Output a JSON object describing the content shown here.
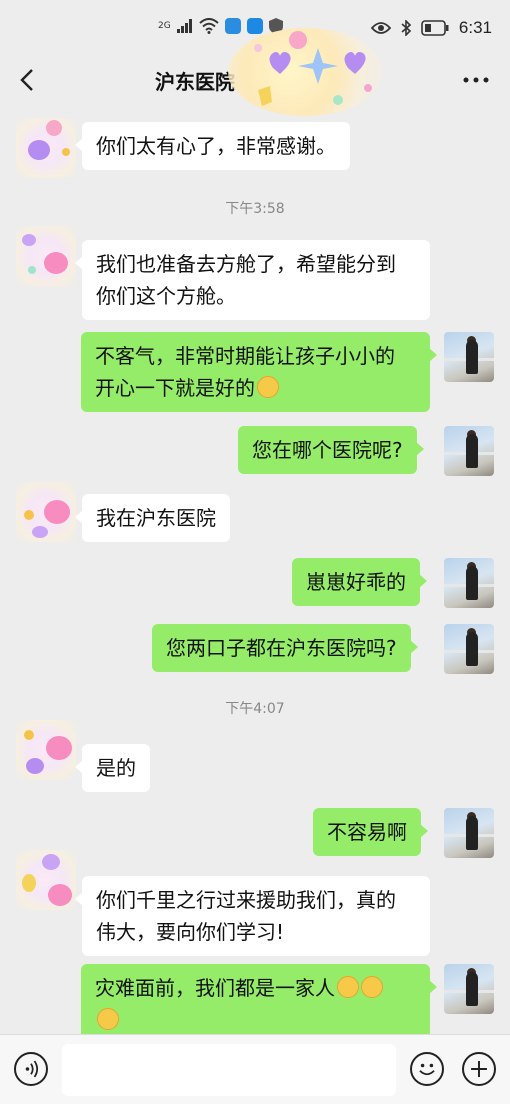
{
  "status_bar": {
    "network": "2G",
    "time": "6:31"
  },
  "header": {
    "title": "沪东医院"
  },
  "messages": [
    {
      "side": "left",
      "text": "你们太有心了，非常感谢。"
    },
    {
      "type": "time",
      "text": "下午3:58"
    },
    {
      "side": "left",
      "lines": [
        "我们也准备去方舱了，希望能分到",
        "你们这个方舱。"
      ]
    },
    {
      "side": "right",
      "lines": [
        "不客气，非常时期能让孩子小小的",
        "开心一下就是好的"
      ],
      "emoji_count": 1
    },
    {
      "side": "right",
      "text": "您在哪个医院呢?"
    },
    {
      "side": "left",
      "text": "我在沪东医院"
    },
    {
      "side": "right",
      "text": "崽崽好乖的"
    },
    {
      "side": "right",
      "text": "您两口子都在沪东医院吗?"
    },
    {
      "type": "time",
      "text": "下午4:07"
    },
    {
      "side": "left",
      "text": "是的"
    },
    {
      "side": "right",
      "text": "不容易啊"
    },
    {
      "side": "left",
      "lines": [
        "你们千里之行过来援助我们，真的",
        "伟大，要向你们学习!"
      ]
    },
    {
      "side": "right",
      "lines": [
        "灾难面前，我们都是一家人"
      ],
      "emoji_count": 3
    }
  ],
  "input": {
    "placeholder": ""
  },
  "colors": {
    "background": "#ededed",
    "bubble_sent": "#95ec69",
    "bubble_received": "#ffffff"
  }
}
